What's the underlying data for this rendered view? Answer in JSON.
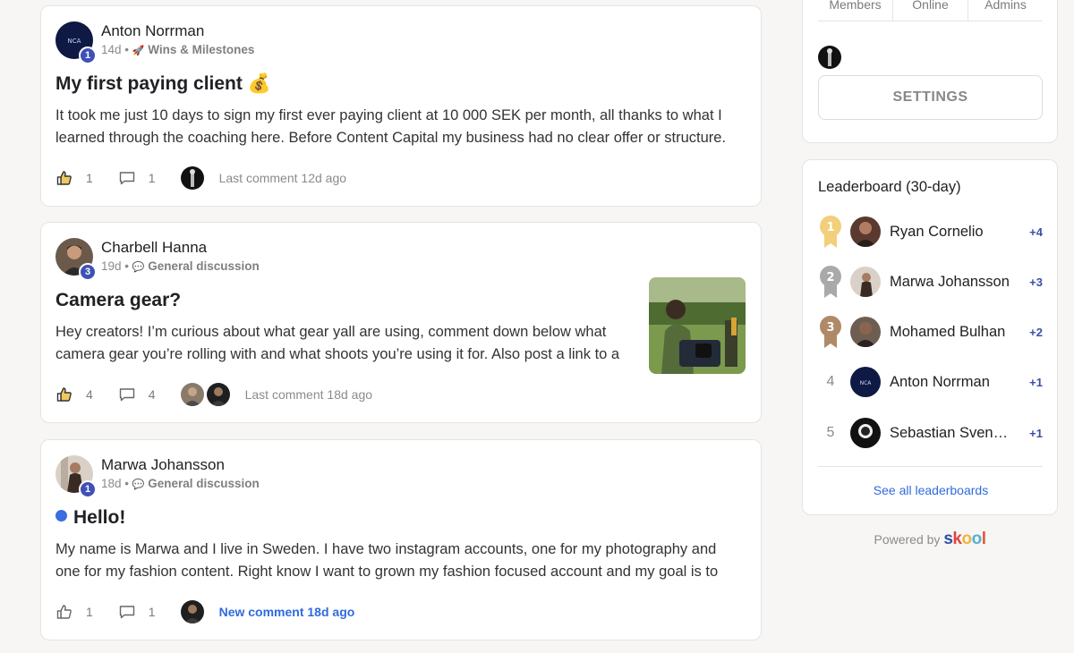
{
  "posts": [
    {
      "author": "Anton Norrman",
      "level": "1",
      "age": "14d",
      "category_icon": "🚀",
      "category": "Wins & Milestones",
      "title": "My first paying client 💰",
      "body": [
        "It took me just 10 days to sign my first ever paying client at 10 000 SEK per month, all thanks to what I",
        "learned through the coaching here. Before Content Capital my business had no clear offer or structure."
      ],
      "likes": "1",
      "comments": "1",
      "last_comment": "Last comment 12d ago"
    },
    {
      "author": "Charbell Hanna",
      "level": "3",
      "age": "19d",
      "category_icon": "💬",
      "category": "General discussion",
      "title": "Camera gear?",
      "body": [
        "Hey creators! I’m curious about what gear yall are using, comment down below what",
        "camera gear you’re rolling with and what shoots you’re using it for. Also post a link to a"
      ],
      "likes": "4",
      "comments": "4",
      "last_comment": "Last comment 18d ago"
    },
    {
      "author": "Marwa Johansson",
      "level": "1",
      "age": "18d",
      "category_icon": "💬",
      "category": "General discussion",
      "title": "Hello!",
      "body": [
        "My name is Marwa and I live in Sweden. I have two instagram accounts, one for my photography and",
        "one for my fashion content. Right know I want to grown my fashion focused account and my goal is to"
      ],
      "likes": "1",
      "comments": "1",
      "last_comment": "New comment 18d ago"
    }
  ],
  "sidebar": {
    "stats": [
      "Members",
      "Online",
      "Admins"
    ],
    "settings_label": "SETTINGS",
    "leaderboard": {
      "title": "Leaderboard (30-day)",
      "rows": [
        {
          "rank": "1",
          "name": "Ryan Cornelio",
          "points": "+4"
        },
        {
          "rank": "2",
          "name": "Marwa Johansson",
          "points": "+3"
        },
        {
          "rank": "3",
          "name": "Mohamed Bulhan",
          "points": "+2"
        },
        {
          "rank": "4",
          "name": "Anton Norrman",
          "points": "+1"
        },
        {
          "rank": "5",
          "name": "Sebastian Svensson",
          "points": "+1"
        }
      ],
      "see_all": "See all leaderboards"
    },
    "powered_by": "Powered by",
    "brand": [
      "s",
      "k",
      "o",
      "o",
      "l"
    ],
    "brand_colors": [
      "#2e4fa7",
      "#e0443f",
      "#f2b33d",
      "#55b0d6",
      "#e05a3a"
    ],
    "medal_colors": {
      "gold": "#f2cf7a",
      "silver": "#a9a9a9",
      "bronze": "#b08966"
    }
  }
}
